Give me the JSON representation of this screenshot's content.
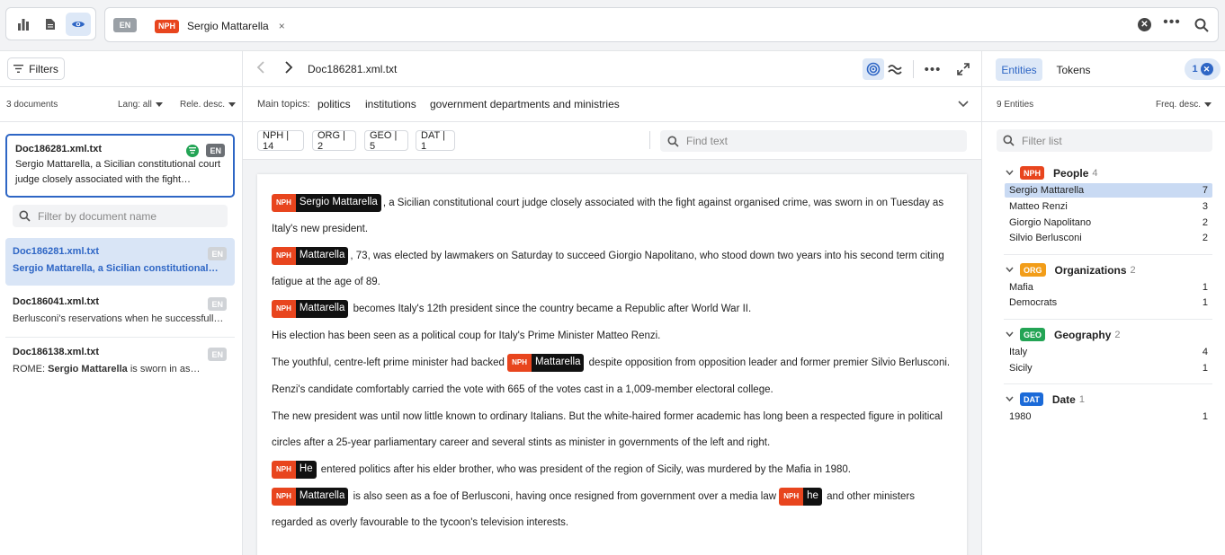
{
  "search": {
    "lang": "EN",
    "chip_tag": "NPH",
    "chip_text": "Sergio Mattarella",
    "chip_close": "×",
    "more": "•••"
  },
  "left": {
    "filters_label": "Filters",
    "doc_count": "3 documents",
    "lang_filter": "Lang: all",
    "sort": "Rele. desc.",
    "filter_placeholder": "Filter by document name",
    "active_doc": {
      "name": "Doc186281.xml.txt",
      "lang": "EN",
      "snippet": "Sergio Mattarella, a Sicilian constitutional court judge closely associated with the fight…"
    },
    "documents": [
      {
        "name": "Doc186281.xml.txt",
        "lang": "EN",
        "snippet": "Sergio Mattarella, a Sicilian constitutional…"
      },
      {
        "name": "Doc186041.xml.txt",
        "lang": "EN",
        "snippet": "Berlusconi's reservations when he successfull…"
      },
      {
        "name": "Doc186138.xml.txt",
        "lang": "EN",
        "snippet_prefix": "ROME: ",
        "snippet_bold": "Sergio Mattarella",
        "snippet_suffix": " is sworn in as…"
      }
    ]
  },
  "center": {
    "doc_title": "Doc186281.xml.txt",
    "more": "•••",
    "topics_label": "Main topics:",
    "topics": [
      "politics",
      "institutions",
      "government departments and ministries"
    ],
    "entity_counts": [
      "NPH | 14",
      "ORG | 2",
      "GEO | 5",
      "DAT | 1"
    ],
    "find_placeholder": "Find text",
    "tag": "NPH",
    "paragraphs": {
      "p1_ent": "Sergio Mattarella",
      "p1": ", a Sicilian constitutional court judge closely associated with the fight against organised crime, was sworn in on Tuesday as Italy's new president.",
      "p2_ent": "Mattarella",
      "p2": ", 73, was elected by lawmakers on Saturday to succeed Giorgio Napolitano, who stood down two years into his second term citing fatigue at the age of 89.",
      "p3_ent": "Mattarella",
      "p3": " becomes Italy's 12th president since the country became a Republic after World War II.",
      "p4": "His election has been seen as a political coup for Italy's Prime Minister Matteo Renzi.",
      "p5_a": "The youthful, centre-left prime minister had backed ",
      "p5_ent": "Mattarella",
      "p5_b": " despite opposition from opposition leader and former premier Silvio Berlusconi.",
      "p6": "Renzi's candidate comfortably carried the vote with 665 of the votes cast in a 1,009-member electoral college.",
      "p7": "The new president was until now little known to ordinary Italians. But the white-haired former academic has long been a respected figure in political circles after a 25-year parliamentary career and several stints as minister in governments of the left and right.",
      "p8_ent": "He",
      "p8": " entered politics after his elder brother, who was president of the region of Sicily, was murdered by the Mafia in 1980.",
      "p9_ent": "Mattarella",
      "p9_a": " is also seen as a foe of Berlusconi, having once resigned from government over a media law ",
      "p9_ent2": "he",
      "p9_b": " and other ministers regarded as overly favourable to the tycoon's television interests."
    }
  },
  "right": {
    "tab_entities": "Entities",
    "tab_tokens": "Tokens",
    "selected_count": "1",
    "entity_count": "9 Entities",
    "sort": "Freq. desc.",
    "filter_placeholder": "Filter list",
    "categories": [
      {
        "tag": "NPH",
        "title": "People",
        "count": "4",
        "items": [
          {
            "name": "Sergio Mattarella",
            "freq": "7"
          },
          {
            "name": "Matteo Renzi",
            "freq": "3"
          },
          {
            "name": "Giorgio Napolitano",
            "freq": "2"
          },
          {
            "name": "Silvio Berlusconi",
            "freq": "2"
          }
        ]
      },
      {
        "tag": "ORG",
        "title": "Organizations",
        "count": "2",
        "items": [
          {
            "name": "Mafia",
            "freq": "1"
          },
          {
            "name": "Democrats",
            "freq": "1"
          }
        ]
      },
      {
        "tag": "GEO",
        "title": "Geography",
        "count": "2",
        "items": [
          {
            "name": "Italy",
            "freq": "4"
          },
          {
            "name": "Sicily",
            "freq": "1"
          }
        ]
      },
      {
        "tag": "DAT",
        "title": "Date",
        "count": "1",
        "items": [
          {
            "name": "1980",
            "freq": "1"
          }
        ]
      }
    ]
  },
  "colors": {
    "accent": "#2e66c5",
    "nph": "#e8451e",
    "org": "#f29d19",
    "geo": "#23a455",
    "dat": "#1b6ad8"
  },
  "icons": [
    "bar-chart-icon",
    "document-icon",
    "eye-icon",
    "close-icon",
    "search-icon",
    "filter-icon",
    "chevron-left-icon",
    "chevron-right-icon",
    "target-icon",
    "wave-icon",
    "expand-icon",
    "chevron-down-icon",
    "topic-icon"
  ]
}
